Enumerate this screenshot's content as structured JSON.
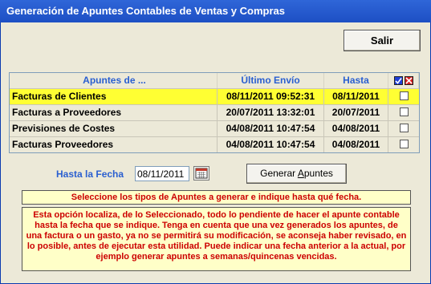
{
  "window": {
    "title": "Generación de Apuntes Contables de Ventas y Compras"
  },
  "buttons": {
    "exit": "Salir",
    "generate_prefix": "Generar ",
    "generate_underlined": "A",
    "generate_suffix": "puntes"
  },
  "table": {
    "headers": [
      "Apuntes de ...",
      "Último Envío",
      "Hasta"
    ],
    "header_icons": [
      "checkbox-checked-icon",
      "checkbox-cross-icon"
    ],
    "rows": [
      {
        "name": "Facturas de Clientes",
        "last_sent": "08/11/2011 09:52:31",
        "until": "08/11/2011",
        "checked": false,
        "selected": true
      },
      {
        "name": "Facturas a Proveedores",
        "last_sent": "20/07/2011 13:32:01",
        "until": "20/07/2011",
        "checked": false,
        "selected": false
      },
      {
        "name": "Previsiones de Costes",
        "last_sent": "04/08/2011 10:47:54",
        "until": "04/08/2011",
        "checked": false,
        "selected": false
      },
      {
        "name": "Facturas Proveedores",
        "last_sent": "04/08/2011 10:47:54",
        "until": "04/08/2011",
        "checked": false,
        "selected": false
      }
    ]
  },
  "date_filter": {
    "label": "Hasta la Fecha",
    "value": "08/11/2011"
  },
  "notes": {
    "instruction": "Seleccione los tipos de Apuntes a generar e indique hasta qué fecha.",
    "explanation": "Esta opción localiza, de lo Seleccionado, todo lo pendiente de hacer el apunte contable hasta la fecha que se indique. Tenga en cuenta que una vez generados los apuntes, de una factura o un gasto, ya no se permitirá su modificación, se aconseja haber revisado, en lo posible, antes de ejecutar esta utilidad. Puede indicar una fecha anterior a la actual, por ejemplo generar apuntes a semanas/quincenas vencidas."
  },
  "colors": {
    "title_bar": "#2f66d8",
    "selected_row": "#ffff33",
    "note_bg": "#ffffc8",
    "note_text": "#cc0000",
    "header_text": "#2a5fd0"
  }
}
